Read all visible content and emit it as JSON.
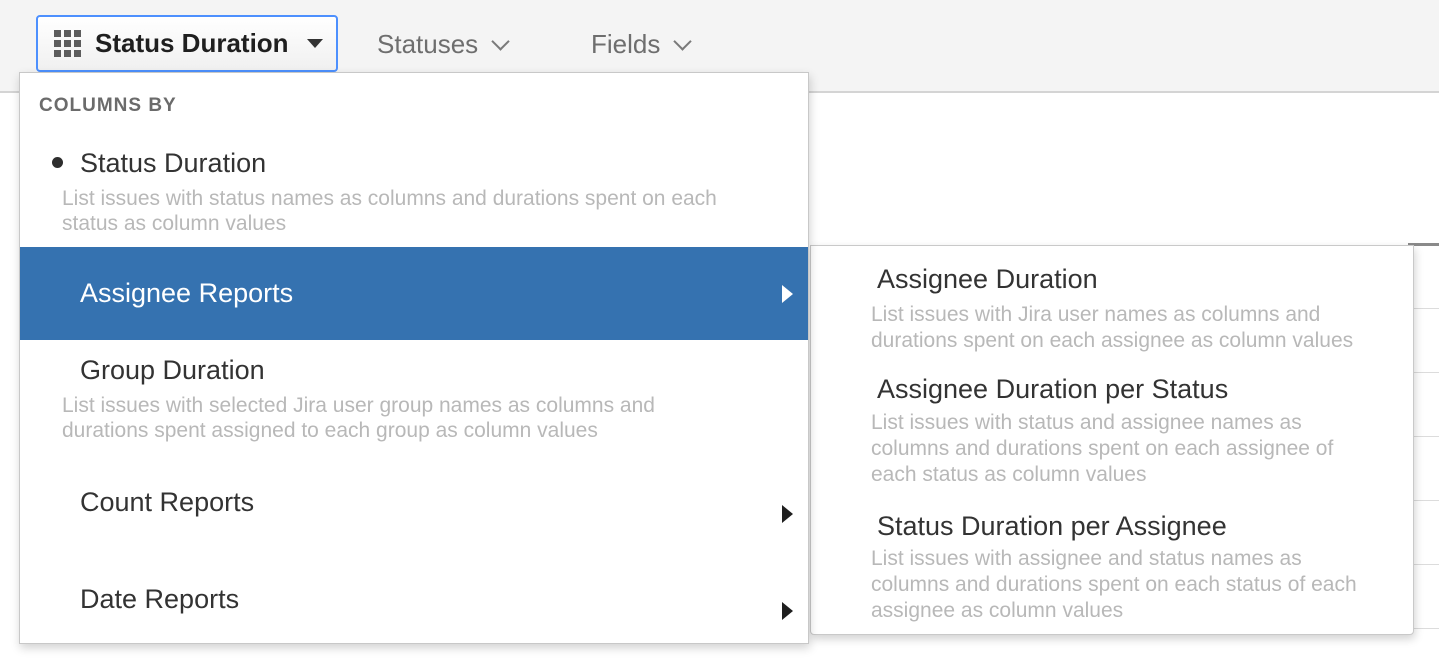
{
  "toolbar": {
    "report_button": {
      "label": "Status Duration"
    },
    "menus": [
      {
        "label": "Statuses"
      },
      {
        "label": "Fields"
      }
    ]
  },
  "dropdown": {
    "section_header": "COLUMNS BY",
    "items": [
      {
        "label": "Status Duration",
        "selected": true,
        "description": "List issues with status names as columns and durations spent on each\nstatus as column values"
      },
      {
        "label": "Assignee Reports",
        "highlighted": true,
        "has_submenu": true
      },
      {
        "label": "Group Duration",
        "description": "List issues with selected Jira user group names as columns and\ndurations spent assigned to each group as column values"
      },
      {
        "label": "Count Reports",
        "has_submenu": true
      },
      {
        "label": "Date Reports",
        "has_submenu": true
      }
    ]
  },
  "submenu": {
    "items": [
      {
        "label": "Assignee Duration",
        "description": "List issues with Jira user names as columns and\ndurations spent on each assignee as column values"
      },
      {
        "label": "Assignee Duration per Status",
        "description": "List issues with status and assignee names as\ncolumns and durations spent on each assignee of\neach status as column values"
      },
      {
        "label": "Status Duration per Assignee",
        "description": "List issues with assignee and status names as\ncolumns and durations spent on each status of each\nassignee as column values"
      }
    ]
  },
  "colors": {
    "highlight_blue": "#3572b0",
    "focus_border_blue": "#4d90fe",
    "toolbar_background": "#f4f4f4",
    "title_text": "#333333",
    "description_text": "#b8b8b8",
    "muted_text": "#6e6e6e"
  }
}
